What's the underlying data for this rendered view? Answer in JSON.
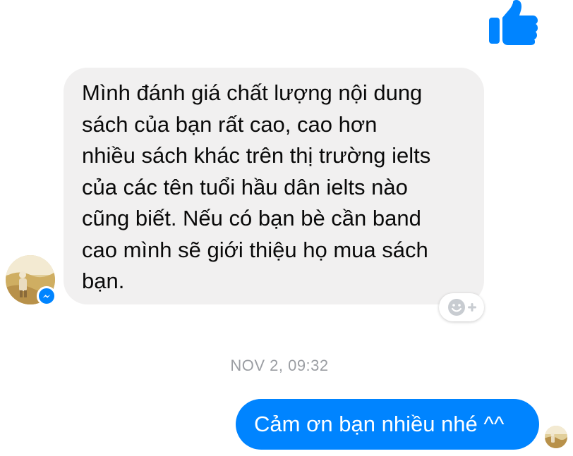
{
  "conversation": {
    "incoming_message": "Mình đánh giá chất lượng nội dung\nsách của bạn rất cao, cao hơn\nnhiều sách khác trên thị trường ielts\ncủa các tên tuổi hầu dân ielts nào\ncũng biết. Nếu có bạn bè cần band\ncao mình sẽ giới thiệu họ mua sách\nbạn.",
    "timestamp": "NOV 2, 09:32",
    "outgoing_message": "Cảm ơn bạn nhiều nhé ^^"
  },
  "colors": {
    "accent": "#0084ff",
    "incoming_bubble": "#f1f0f0",
    "timestamp_text": "#9b9ea3"
  },
  "icons": {
    "like": "thumbs-up-icon",
    "reaction": "add-reaction-icon",
    "badge": "messenger-icon"
  }
}
